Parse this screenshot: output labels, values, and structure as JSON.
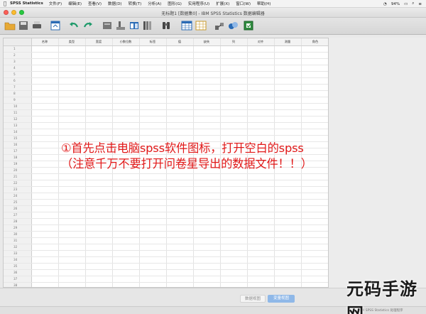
{
  "menubar": {
    "app_name": "SPSS Statistics",
    "items": [
      "文件(F)",
      "编辑(E)",
      "查看(V)",
      "数据(D)",
      "转换(T)",
      "分析(A)",
      "图形(G)",
      "实用程序(U)",
      "扩展(X)",
      "窗口(W)",
      "帮助(H)"
    ],
    "battery": "94%"
  },
  "window": {
    "title": "无标题1 [数据集0] - IBM SPSS Statistics 数据编辑器"
  },
  "toolbar": {
    "icons": [
      "open-icon",
      "save-icon",
      "print-icon",
      "recall-dialog-icon",
      "undo-icon",
      "redo-icon",
      "goto-case-icon",
      "goto-variable-icon",
      "variables-icon",
      "find-icon",
      "insert-cases-icon",
      "insert-variable-icon",
      "split-file-icon",
      "weight-cases-icon",
      "select-cases-icon"
    ]
  },
  "grid": {
    "columns": [
      "名称",
      "类型",
      "宽度",
      "小数位数",
      "标签",
      "值",
      "缺失",
      "列",
      "对齐",
      "测量",
      "角色"
    ],
    "row_numbers": [
      "1",
      "2",
      "3",
      "4",
      "5",
      "6",
      "7",
      "8",
      "9",
      "10",
      "11",
      "12",
      "13",
      "14",
      "15",
      "16",
      "17",
      "18",
      "19",
      "20",
      "21",
      "22",
      "23",
      "24",
      "25",
      "26",
      "27",
      "28",
      "29",
      "30",
      "31",
      "32",
      "33",
      "34",
      "35",
      "36",
      "37",
      "38",
      "39"
    ]
  },
  "annotation": {
    "line1": "①首先点击电脑spss软件图标，打开空白的spss",
    "line2": "（注意千万不要打开问卷星导出的数据文件！！）"
  },
  "tabs": {
    "data_view": "数据视图",
    "variable_view": "变量视图"
  },
  "status": {
    "text": "IBM SPSS Statistics 处理程序"
  },
  "watermark": {
    "text": "元码手游网"
  },
  "colors": {
    "annotation_red": "#e11818",
    "active_tab": "#8fb8e8"
  }
}
